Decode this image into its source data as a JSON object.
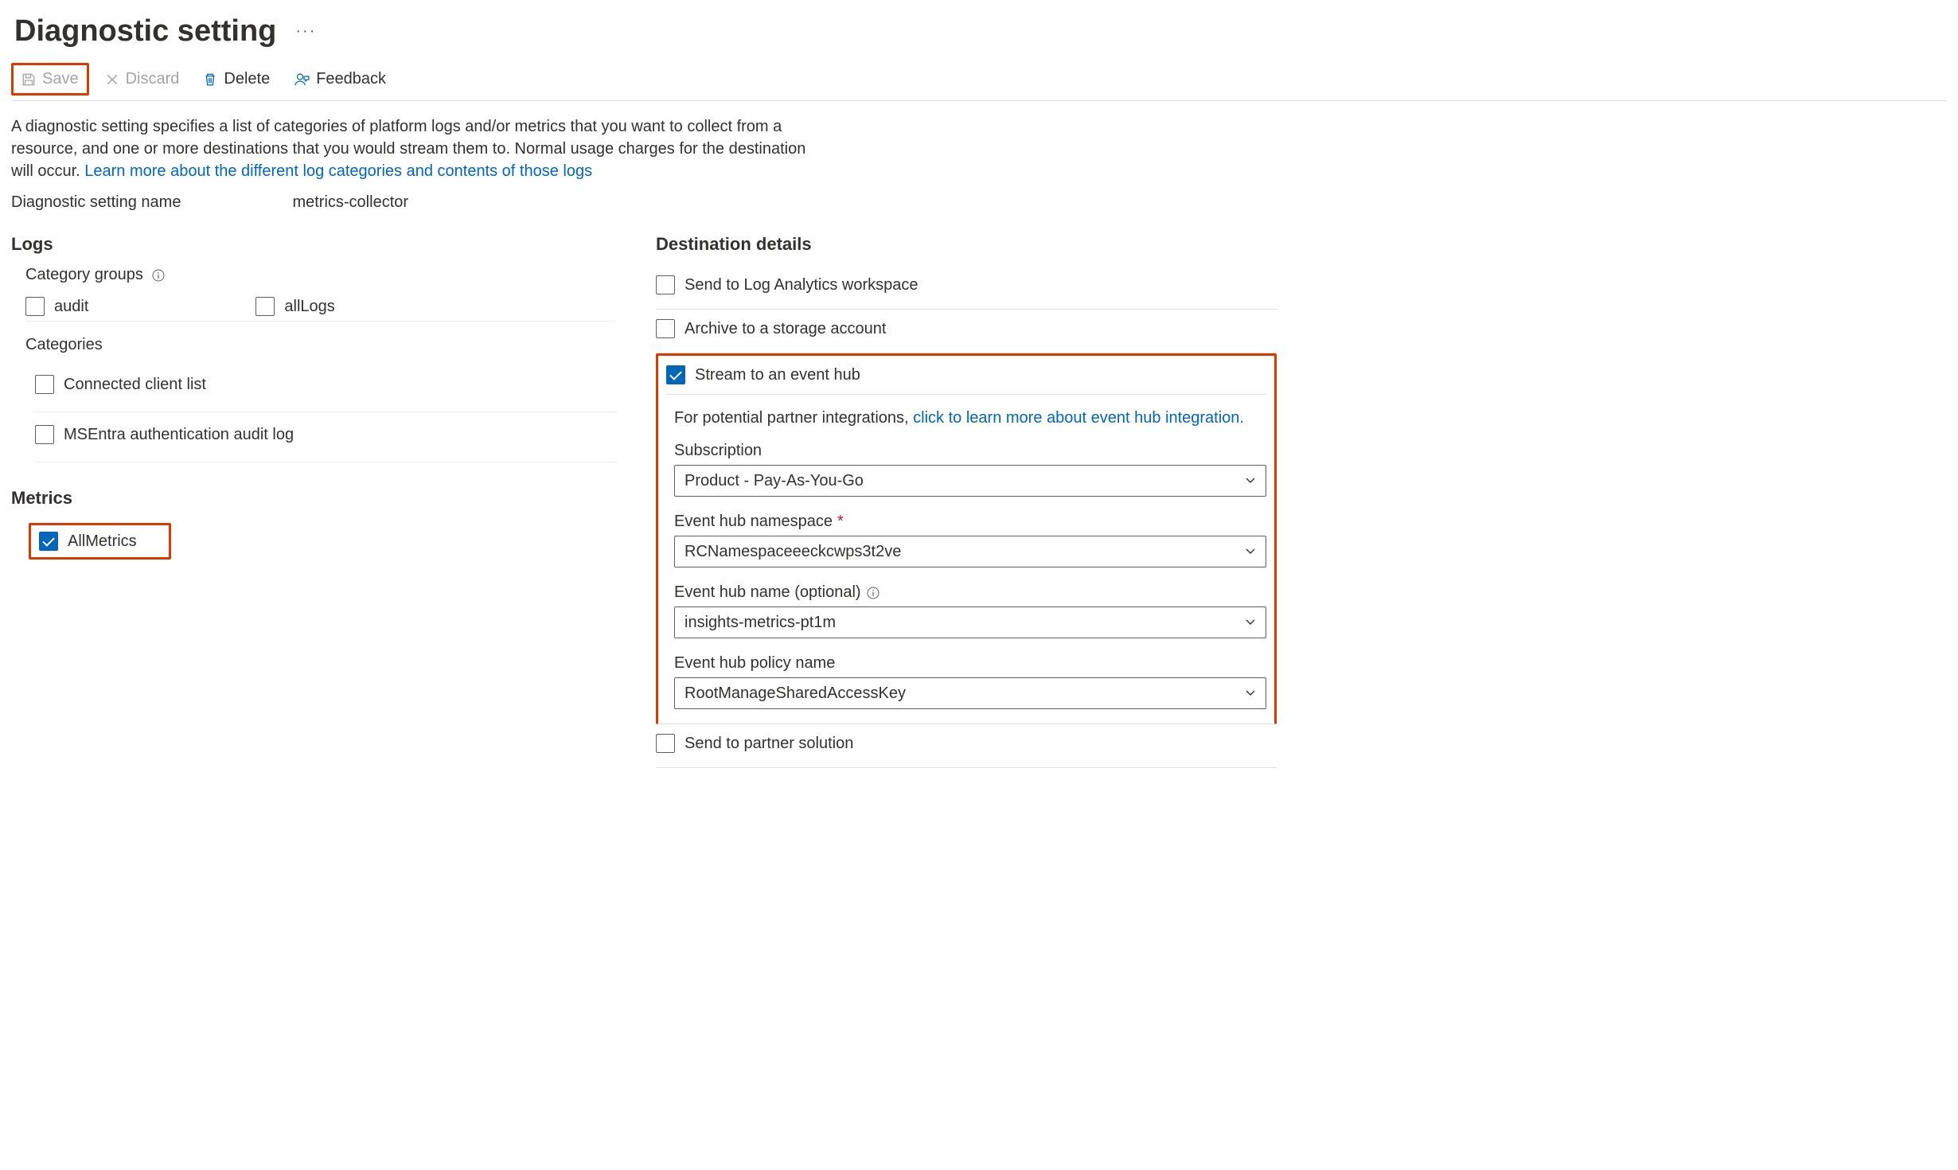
{
  "title": "Diagnostic setting",
  "toolbar": {
    "save": "Save",
    "discard": "Discard",
    "delete": "Delete",
    "feedback": "Feedback"
  },
  "description": {
    "text": "A diagnostic setting specifies a list of categories of platform logs and/or metrics that you want to collect from a resource, and one or more destinations that you would stream them to. Normal usage charges for the destination will occur. ",
    "link": "Learn more about the different log categories and contents of those logs"
  },
  "settingNameLabel": "Diagnostic setting name",
  "settingNameValue": "metrics-collector",
  "logs": {
    "heading": "Logs",
    "categoryGroupsLabel": "Category groups",
    "groups": {
      "audit": "audit",
      "allLogs": "allLogs"
    },
    "categoriesLabel": "Categories",
    "categories": {
      "connectedClientList": "Connected client list",
      "msentra": "MSEntra authentication audit log"
    }
  },
  "metrics": {
    "heading": "Metrics",
    "allMetrics": "AllMetrics"
  },
  "destinations": {
    "heading": "Destination details",
    "logAnalytics": "Send to Log Analytics workspace",
    "storage": "Archive to a storage account",
    "eventHub": {
      "label": "Stream to an event hub",
      "introPrefix": "For potential partner integrations, ",
      "introLink": "click to learn more about event hub integration.",
      "subscriptionLabel": "Subscription",
      "subscriptionValue": "Product - Pay-As-You-Go",
      "namespaceLabel": "Event hub namespace",
      "namespaceValue": "RCNamespaceeeckcwps3t2ve",
      "hubNameLabel": "Event hub name (optional)",
      "hubNameValue": "insights-metrics-pt1m",
      "policyLabel": "Event hub policy name",
      "policyValue": "RootManageSharedAccessKey"
    },
    "partner": "Send to partner solution"
  }
}
